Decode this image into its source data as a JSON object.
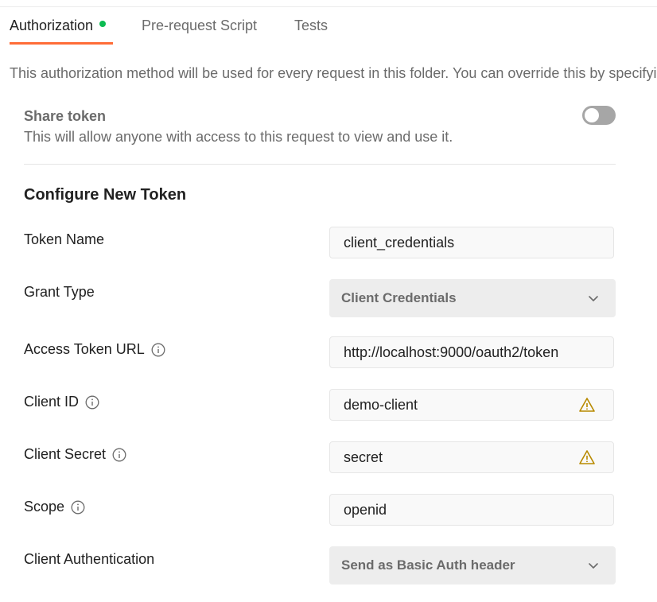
{
  "tabs": [
    {
      "label": "Authorization",
      "active": true,
      "has_indicator_dot": true
    },
    {
      "label": "Pre-request Script",
      "active": false
    },
    {
      "label": "Tests",
      "active": false
    }
  ],
  "info_text": "This authorization method will be used for every request in this folder. You can override this by specifying one in the request.",
  "share": {
    "title": "Share token",
    "description": "This will allow anyone with access to this request to view and use it.",
    "enabled": false
  },
  "section_title": "Configure New Token",
  "fields": {
    "token_name": {
      "label": "Token Name",
      "value": "client_credentials"
    },
    "grant_type": {
      "label": "Grant Type",
      "value": "Client Credentials"
    },
    "access_token_url": {
      "label": "Access Token URL",
      "value": "http://localhost:9000/oauth2/token"
    },
    "client_id": {
      "label": "Client ID",
      "value": "demo-client",
      "warning": true
    },
    "client_secret": {
      "label": "Client Secret",
      "value": "secret",
      "warning": true
    },
    "scope": {
      "label": "Scope",
      "value": "openid"
    },
    "client_authentication": {
      "label": "Client Authentication",
      "value": "Send as Basic Auth header"
    }
  },
  "colors": {
    "accent": "#ff6c37",
    "indicator": "#0cbb52",
    "warning": "#b88a00"
  }
}
